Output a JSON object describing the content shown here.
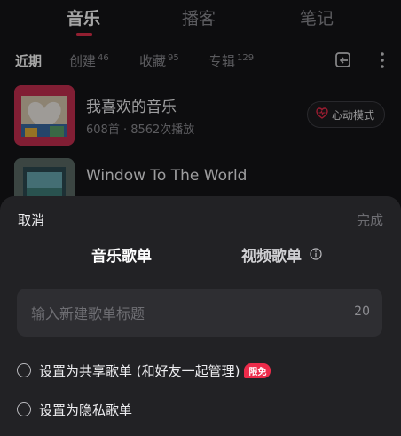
{
  "top_tabs": [
    {
      "label": "音乐",
      "active": true
    },
    {
      "label": "播客",
      "active": false
    },
    {
      "label": "笔记",
      "active": false
    }
  ],
  "sub_tabs": [
    {
      "label": "近期",
      "count": ""
    },
    {
      "label": "创建",
      "count": "46"
    },
    {
      "label": "收藏",
      "count": "95"
    },
    {
      "label": "专辑",
      "count": "129"
    }
  ],
  "playlists": [
    {
      "title": "我喜欢的音乐",
      "meta": "608首 · 8562次播放",
      "action": "心动模式"
    },
    {
      "title": "Window To The World",
      "meta": ""
    }
  ],
  "sheet": {
    "cancel": "取消",
    "done": "完成",
    "segments": [
      {
        "label": "音乐歌单",
        "active": true
      },
      {
        "label": "视频歌单",
        "active": false
      }
    ],
    "input": {
      "placeholder": "输入新建歌单标题",
      "value": "",
      "limit": "20"
    },
    "options": [
      {
        "label": "设置为共享歌单 (和好友一起管理)",
        "badge": "限免"
      },
      {
        "label": "设置为隐私歌单",
        "badge": ""
      }
    ]
  },
  "colors": {
    "accent": "#e0304c",
    "background": "#151517",
    "sheet": "#222225"
  },
  "icons": [
    "recent-sync-icon",
    "more-vertical-icon",
    "heart-pulse-icon",
    "info-icon"
  ]
}
